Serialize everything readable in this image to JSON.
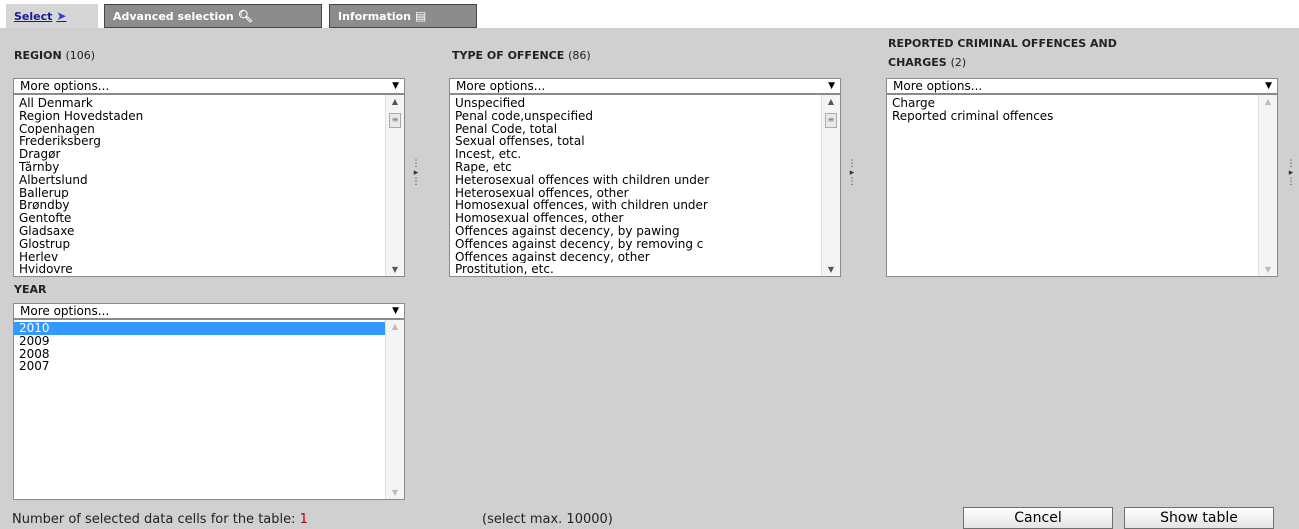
{
  "tabs": [
    {
      "label": "Select",
      "icon": "cursor-arrow-icon"
    },
    {
      "label": "Advanced selection",
      "icon": "magnifier-icon"
    },
    {
      "label": "Information",
      "icon": "info-icon"
    }
  ],
  "region": {
    "title": "REGION",
    "count": "(106)",
    "dropdown": "More options...",
    "items": [
      "All Denmark",
      "Region Hovedstaden",
      "Copenhagen",
      "Frederiksberg",
      "Dragør",
      "Tårnby",
      "Albertslund",
      "Ballerup",
      "Brøndby",
      "Gentofte",
      "Gladsaxe",
      "Glostrup",
      "Herlev",
      "Hvidovre"
    ]
  },
  "offence": {
    "title": "TYPE OF OFFENCE",
    "count": "(86)",
    "dropdown": "More options...",
    "items": [
      "Unspecified",
      "Penal code,unspecified",
      "Penal Code, total",
      "Sexual offenses, total",
      "Incest, etc.",
      "Rape, etc",
      "Heterosexual offences with children under",
      "Heterosexual offences, other",
      "Homosexual offences, with children under",
      "Homosexual offences, other",
      "Offences against decency, by pawing",
      "Offences against decency, by removing c",
      "Offences against decency, other",
      "Prostitution, etc."
    ]
  },
  "reported": {
    "title_line1": "REPORTED CRIMINAL OFFENCES AND",
    "title_line2": "CHARGES",
    "count": "(2)",
    "dropdown": "More options...",
    "items": [
      "Charge",
      "Reported criminal offences"
    ]
  },
  "year": {
    "title": "YEAR",
    "dropdown": "More options...",
    "items": [
      "2010",
      "2009",
      "2008",
      "2007"
    ],
    "selected_index": 0
  },
  "status": {
    "label": "Number of selected data cells for the table:",
    "count": "1",
    "max": "(select max. 10000)"
  },
  "buttons": {
    "cancel": "Cancel",
    "show": "Show table"
  },
  "colors": {
    "panel": "#d0d0d0",
    "selection": "#3399ff",
    "count_red": "#c00000"
  }
}
